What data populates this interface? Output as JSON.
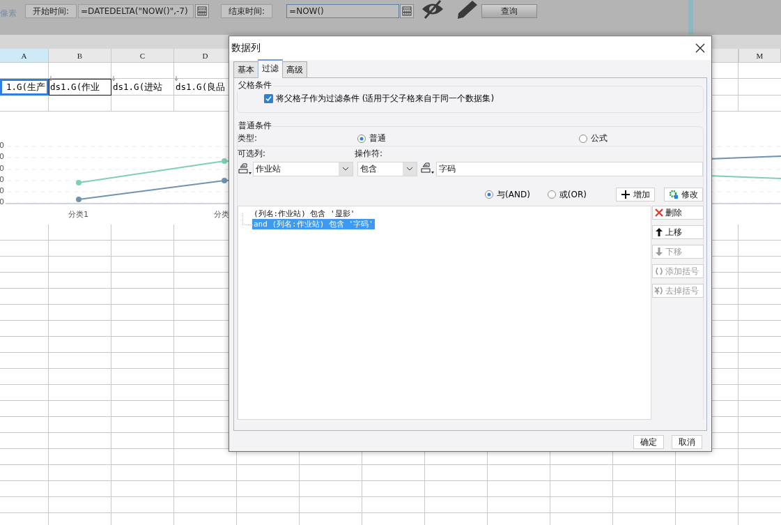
{
  "toolbar": {
    "unit_label": "像素",
    "start_label": "开始时间:",
    "start_value": "=DATEDELTA(\"NOW()\",-7)",
    "end_label": "结束时间:",
    "end_value": "=NOW()",
    "end_selected": true,
    "query_button": "查询"
  },
  "sheet": {
    "columns": [
      {
        "label": "A",
        "selected": true
      },
      {
        "label": "B",
        "selected": false
      },
      {
        "label": "C",
        "selected": false
      },
      {
        "label": "D",
        "selected": false
      },
      {
        "label": "M",
        "selected": false
      }
    ],
    "cells": [
      {
        "text": "1.G(生产",
        "selected": true,
        "outlined": false
      },
      {
        "text": "ds1.G(作业",
        "selected": false,
        "outlined": true
      },
      {
        "text": "ds1.G(进站",
        "selected": false,
        "outlined": false
      },
      {
        "text": "ds1.G(良品",
        "selected": false,
        "outlined": false
      }
    ],
    "chart": {
      "y_labels": [
        "0",
        "0",
        "0",
        "0",
        "0",
        "0"
      ],
      "x_labels": [
        "分类1",
        "分类"
      ]
    }
  },
  "dialog": {
    "title": "数据列",
    "tabs": [
      {
        "label": "基本",
        "selected": false
      },
      {
        "label": "过滤",
        "selected": true
      },
      {
        "label": "高级",
        "selected": false
      }
    ],
    "parent_section": {
      "title": "父格条件",
      "checkbox": {
        "label": "将父格子作为过滤条件 (适用于父子格来自于同一个数据集)",
        "checked": true
      }
    },
    "normal_section": {
      "title": "普通条件",
      "type_label": "类型:",
      "type_options": [
        {
          "label": "普通",
          "selected": true
        },
        {
          "label": "公式",
          "selected": false
        }
      ],
      "column_label": "可选列:",
      "operator_label": "操作符:",
      "column_value": "作业站",
      "operator_value": "包含",
      "value": "字码",
      "logic_options": [
        {
          "label": "与(AND)",
          "selected": true
        },
        {
          "label": "或(OR)",
          "selected": false
        }
      ],
      "add_button": "增加",
      "modify_button": "修改",
      "conditions": [
        {
          "text": "(列名:作业站) 包含 '显影'",
          "selected": false
        },
        {
          "text": "and (列名:作业站) 包含 '字码'",
          "selected": true
        }
      ],
      "side_buttons": [
        {
          "label": "删除",
          "kind": "delete",
          "disabled": false
        },
        {
          "label": "上移",
          "kind": "up",
          "disabled": false
        },
        {
          "label": "下移",
          "kind": "down",
          "disabled": true
        },
        {
          "label": "添加括号",
          "kind": "add-bracket",
          "disabled": true
        },
        {
          "label": "去掉括号",
          "kind": "remove-bracket",
          "disabled": true
        }
      ]
    },
    "footer_buttons": [
      "确定",
      "取消"
    ]
  }
}
